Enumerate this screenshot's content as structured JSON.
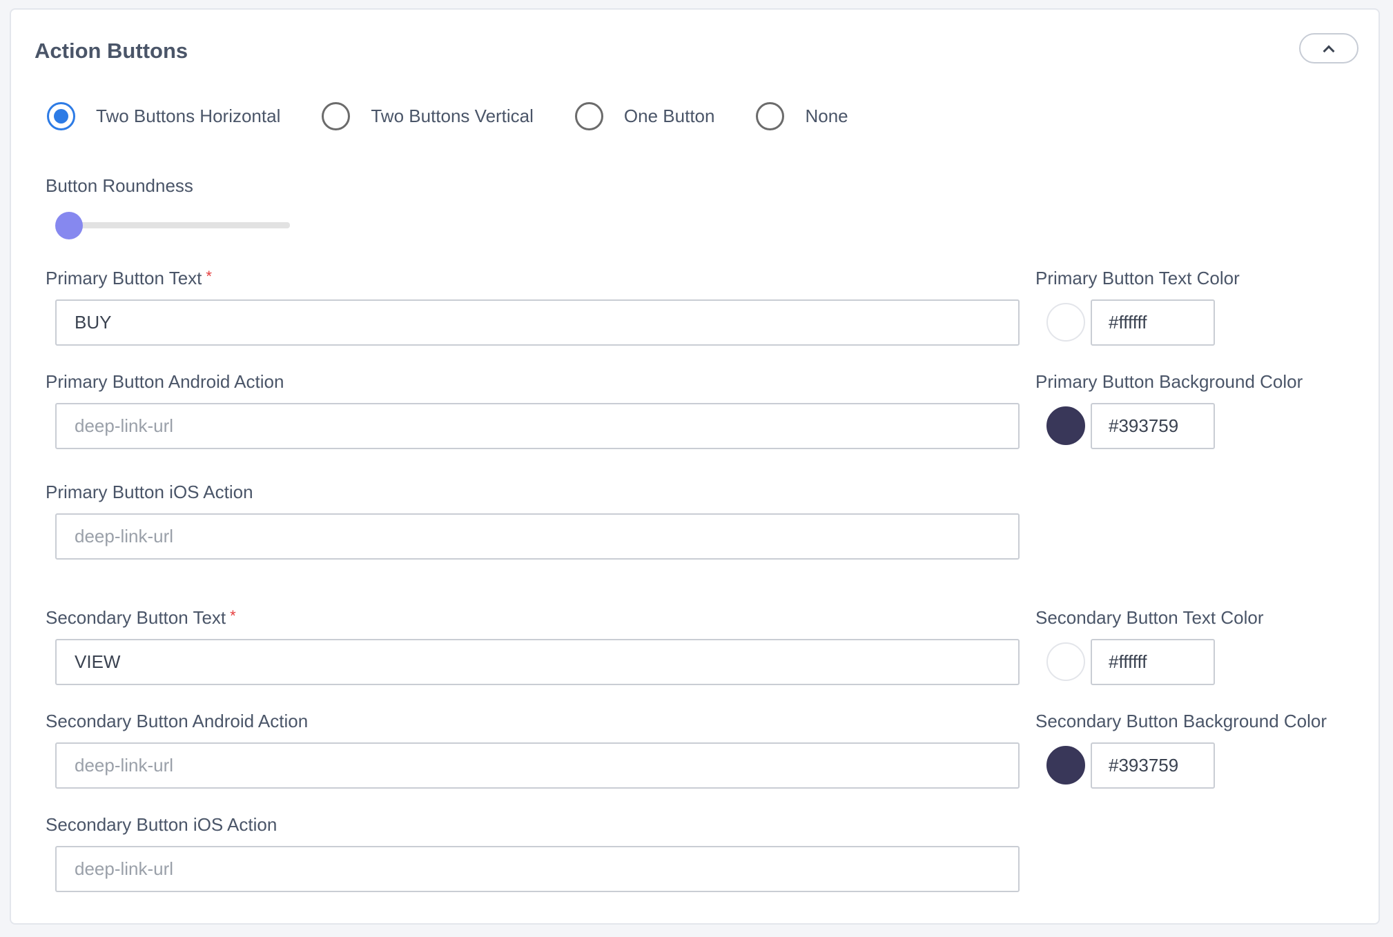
{
  "title": "Action Buttons",
  "layout_options": [
    {
      "label": "Two Buttons Horizontal",
      "checked": true
    },
    {
      "label": "Two Buttons Vertical",
      "checked": false
    },
    {
      "label": "One Button",
      "checked": false
    },
    {
      "label": "None",
      "checked": false
    }
  ],
  "roundness": {
    "label": "Button Roundness",
    "value_fraction": 0
  },
  "primary": {
    "text_label": "Primary Button Text",
    "required_mark": "*",
    "text_value": "BUY",
    "android_label": "Primary Button Android Action",
    "android_placeholder": "deep-link-url",
    "ios_label": "Primary Button iOS Action",
    "ios_placeholder": "deep-link-url",
    "text_color_label": "Primary Button Text Color",
    "text_color_value": "#ffffff",
    "bg_color_label": "Primary Button Background Color",
    "bg_color_value": "#393759"
  },
  "secondary": {
    "text_label": "Secondary Button Text",
    "required_mark": "*",
    "text_value": "VIEW",
    "android_label": "Secondary Button Android Action",
    "android_placeholder": "deep-link-url",
    "ios_label": "Secondary Button iOS Action",
    "ios_placeholder": "deep-link-url",
    "text_color_label": "Secondary Button Text Color",
    "text_color_value": "#ffffff",
    "bg_color_label": "Secondary Button Background Color",
    "bg_color_value": "#393759"
  },
  "colors": {
    "accent": "#2d7be5",
    "slider_thumb": "#8688ef",
    "required": "#e53e3e"
  },
  "icons": {
    "collapse": "chevron-up-icon"
  }
}
